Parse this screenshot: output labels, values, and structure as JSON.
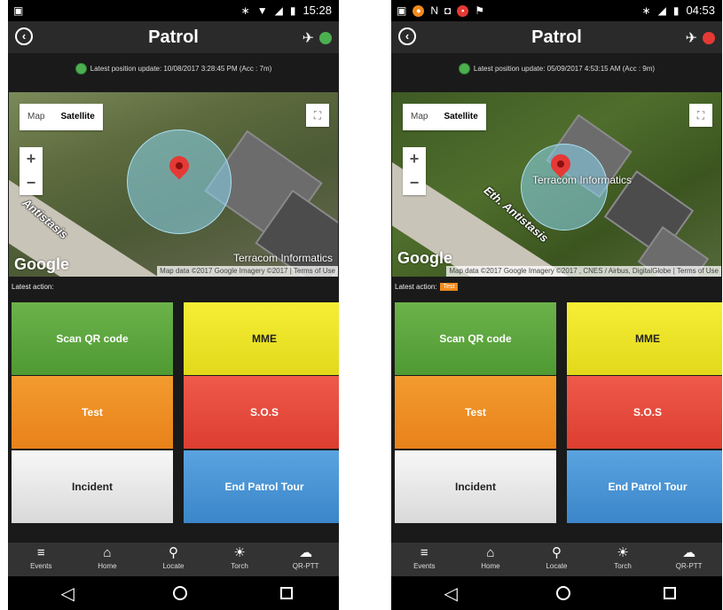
{
  "screens": [
    {
      "status_bar": {
        "time": "15:28"
      },
      "app_bar": {
        "title": "Patrol",
        "status_color": "#4caf50"
      },
      "position": {
        "text": "Latest position update: 10/08/2017 3:28:45 PM (Acc : 7m)"
      },
      "map": {
        "type_map": "Map",
        "type_satellite": "Satellite",
        "zoom_in": "+",
        "zoom_out": "−",
        "street_label": "Antistasis",
        "company_label": "Terracom Informatics",
        "google": "Google",
        "attribution": "Map data ©2017 Google Imagery ©2017 | Terms of Use"
      },
      "latest_action": {
        "label": "Latest action:",
        "badge": ""
      },
      "tiles": {
        "scan": "Scan QR code",
        "mme": "MME",
        "test": "Test",
        "sos": "S.O.S",
        "incident": "Incident",
        "end": "End Patrol Tour"
      }
    },
    {
      "status_bar": {
        "time": "04:53"
      },
      "app_bar": {
        "title": "Patrol",
        "status_color": "#e53935"
      },
      "position": {
        "text": "Latest position update: 05/09/2017 4:53:15 AM (Acc : 9m)"
      },
      "map": {
        "type_map": "Map",
        "type_satellite": "Satellite",
        "zoom_in": "+",
        "zoom_out": "−",
        "street_label": "Eth. Antistasis",
        "company_label": "Terracom Informatics",
        "google": "Google",
        "attribution": "Map data ©2017 Google Imagery ©2017 , CNES / Airbus, DigitalGlobe | Terms of Use"
      },
      "latest_action": {
        "label": "Latest action:",
        "badge": "Test"
      },
      "tiles": {
        "scan": "Scan QR code",
        "mme": "MME",
        "test": "Test",
        "sos": "S.O.S",
        "incident": "Incident",
        "end": "End Patrol Tour"
      }
    }
  ],
  "bottom_nav": {
    "events": "Events",
    "home": "Home",
    "locate": "Locate",
    "torch": "Torch",
    "qrptt": "QR-PTT"
  },
  "icons": {
    "back": "back-circle-icon",
    "satellite": "satellite-icon",
    "events": "database-stack-icon",
    "home": "home-icon",
    "locate": "location-pin-icon",
    "torch": "sun-icon",
    "qrptt": "cloud-upload-icon"
  }
}
